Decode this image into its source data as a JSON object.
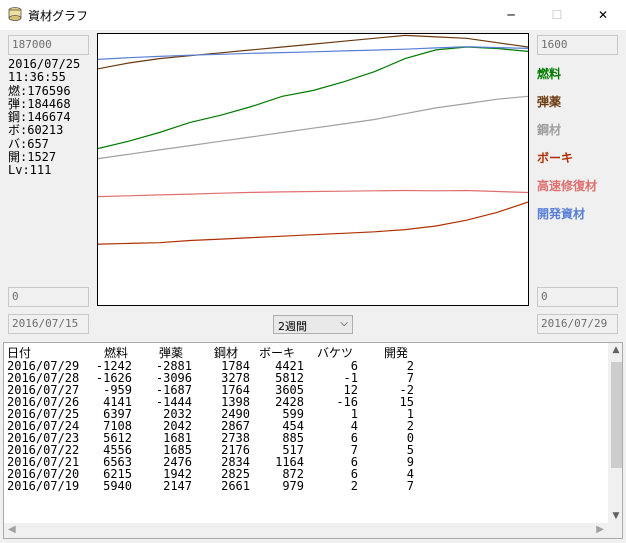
{
  "window": {
    "title": "資材グラフ",
    "minimize_glyph": "─",
    "maximize_glyph": "☐",
    "close_glyph": "✕"
  },
  "left_panel": {
    "y_max": "187000",
    "y_min": "0",
    "date_from": "2016/07/15",
    "stats": [
      "2016/07/25",
      "11:36:55",
      "燃:176596",
      "弾:184468",
      "鋼:146674",
      "ボ:60213",
      "バ:657",
      "開:1527",
      "Lv:111"
    ]
  },
  "right_panel": {
    "y_max": "1600",
    "y_min": "0",
    "date_to": "2016/07/29"
  },
  "legend": [
    {
      "label": "燃料",
      "color": "#007a00"
    },
    {
      "label": "弾薬",
      "color": "#6b3a0e"
    },
    {
      "label": "鋼材",
      "color": "#a0a0a0"
    },
    {
      "label": "ボーキ",
      "color": "#b03000"
    },
    {
      "label": "高速修復材",
      "color": "#e07070"
    },
    {
      "label": "開発資材",
      "color": "#5a7fd8"
    }
  ],
  "period_select": {
    "value": "2週間",
    "chevron": "⌵"
  },
  "table": {
    "headers": [
      "日付",
      "燃料",
      "弾薬",
      "鋼材",
      "ボーキ",
      "バケツ",
      "開発"
    ],
    "rows": [
      [
        "2016/07/29",
        "-1242",
        "-2881",
        "1784",
        "4421",
        "6",
        "2"
      ],
      [
        "2016/07/28",
        "-1626",
        "-3096",
        "3278",
        "5812",
        "-1",
        "7"
      ],
      [
        "2016/07/27",
        "-959",
        "-1687",
        "1764",
        "3605",
        "12",
        "-2"
      ],
      [
        "2016/07/26",
        "4141",
        "-1444",
        "1398",
        "2428",
        "-16",
        "15"
      ],
      [
        "2016/07/25",
        "6397",
        "2032",
        "2490",
        "599",
        "1",
        "1"
      ],
      [
        "2016/07/24",
        "7108",
        "2042",
        "2867",
        "454",
        "4",
        "2"
      ],
      [
        "2016/07/23",
        "5612",
        "1681",
        "2738",
        "885",
        "6",
        "0"
      ],
      [
        "2016/07/22",
        "4556",
        "1685",
        "2176",
        "517",
        "7",
        "5"
      ],
      [
        "2016/07/21",
        "6563",
        "2476",
        "2834",
        "1164",
        "6",
        "9"
      ],
      [
        "2016/07/20",
        "6215",
        "1942",
        "2825",
        "872",
        "6",
        "4"
      ],
      [
        "2016/07/19",
        "5940",
        "2147",
        "2661",
        "979",
        "2",
        "7"
      ]
    ]
  },
  "chart_data": {
    "type": "line",
    "x": [
      "2016/07/15",
      "2016/07/16",
      "2016/07/17",
      "2016/07/18",
      "2016/07/19",
      "2016/07/20",
      "2016/07/21",
      "2016/07/22",
      "2016/07/23",
      "2016/07/24",
      "2016/07/25",
      "2016/07/26",
      "2016/07/27",
      "2016/07/28",
      "2016/07/29"
    ],
    "left_axis": {
      "ylim": [
        0,
        187000
      ]
    },
    "right_axis": {
      "ylim": [
        0,
        1600
      ]
    },
    "series": [
      {
        "name": "燃料",
        "axis": "left",
        "color": "#007a00",
        "values": [
          108000,
          113000,
          119000,
          126000,
          131000,
          137000,
          144000,
          148000,
          154000,
          161000,
          170000,
          176000,
          178000,
          177000,
          175000
        ]
      },
      {
        "name": "弾薬",
        "axis": "left",
        "color": "#6b3a0e",
        "values": [
          163000,
          167000,
          170000,
          172000,
          174000,
          176000,
          178000,
          180000,
          182000,
          184000,
          186000,
          185000,
          184000,
          181000,
          178000
        ]
      },
      {
        "name": "鋼材",
        "axis": "left",
        "color": "#a0a0a0",
        "values": [
          101000,
          104000,
          107000,
          110000,
          113000,
          116000,
          119000,
          122000,
          125000,
          128000,
          132000,
          136000,
          139000,
          142000,
          144000
        ]
      },
      {
        "name": "ボーキ",
        "axis": "left",
        "color": "#b03000",
        "values": [
          42000,
          42500,
          43000,
          44500,
          45500,
          46500,
          47500,
          48500,
          49500,
          50500,
          52000,
          54500,
          58500,
          64000,
          71000
        ]
      },
      {
        "name": "高速修復材",
        "axis": "right",
        "color": "#e07070",
        "values": [
          640,
          645,
          650,
          655,
          660,
          665,
          668,
          670,
          672,
          674,
          676,
          674,
          676,
          670,
          664
        ]
      },
      {
        "name": "開発資材",
        "axis": "right",
        "color": "#5a7fd8",
        "values": [
          1450,
          1460,
          1468,
          1475,
          1480,
          1486,
          1490,
          1495,
          1500,
          1505,
          1510,
          1518,
          1525,
          1520,
          1515
        ]
      }
    ],
    "grid": false
  }
}
